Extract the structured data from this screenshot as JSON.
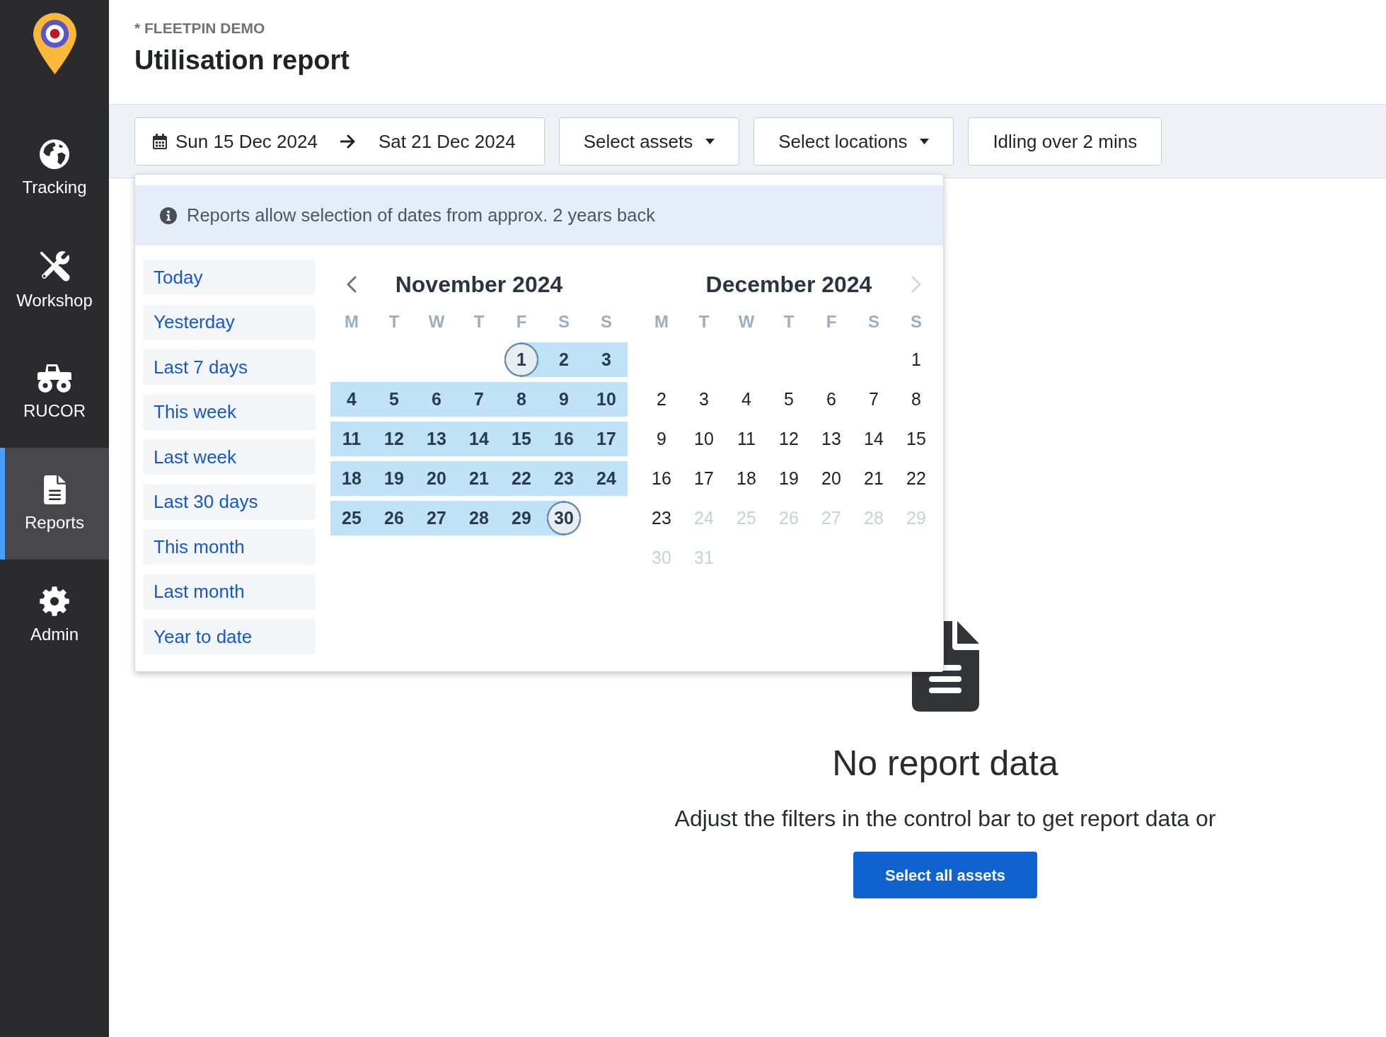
{
  "sidebar": {
    "items": [
      {
        "label": "Tracking",
        "selected": false
      },
      {
        "label": "Workshop",
        "selected": false
      },
      {
        "label": "RUCOR",
        "selected": false
      },
      {
        "label": "Reports",
        "selected": true
      },
      {
        "label": "Admin",
        "selected": false
      }
    ]
  },
  "header": {
    "account": "* FLEETPIN DEMO",
    "title": "Utilisation report"
  },
  "filters": [
    {
      "kind": "date_range",
      "start": "Sun 15 Dec 2024",
      "end": "Sat 21 Dec 2024",
      "expanded": true,
      "picker": {
        "notice": "Reports allow selection of dates from approx. 2 years back",
        "presets": [
          "Today",
          "Yesterday",
          "Last 7 days",
          "This week",
          "Last week",
          "Last 30 days",
          "This month",
          "Last month",
          "Year to date"
        ],
        "prev_button": {
          "disabled": false
        },
        "next_button": {
          "disabled": true
        },
        "months": [
          {
            "title": "November 2024",
            "weekdays": [
              "M",
              "T",
              "W",
              "T",
              "F",
              "S",
              "S"
            ],
            "weeks": [
              [
                {
                  "day": "1",
                  "kind": "range_start",
                  "disabled": false
                },
                {
                  "day": "2",
                  "kind": "range_middle",
                  "disabled": false
                },
                {
                  "day": "3",
                  "kind": "range_middle",
                  "disabled": false
                }
              ],
              [
                {
                  "day": "4",
                  "kind": "range_middle",
                  "disabled": false
                },
                {
                  "day": "5",
                  "kind": "range_middle",
                  "disabled": false
                },
                {
                  "day": "6",
                  "kind": "range_middle",
                  "disabled": false
                },
                {
                  "day": "7",
                  "kind": "range_middle",
                  "disabled": false
                },
                {
                  "day": "8",
                  "kind": "range_middle",
                  "disabled": false
                },
                {
                  "day": "9",
                  "kind": "range_middle",
                  "disabled": false
                },
                {
                  "day": "10",
                  "kind": "range_middle",
                  "disabled": false
                }
              ],
              [
                {
                  "day": "11",
                  "kind": "range_middle",
                  "disabled": false
                },
                {
                  "day": "12",
                  "kind": "range_middle",
                  "disabled": false
                },
                {
                  "day": "13",
                  "kind": "range_middle",
                  "disabled": false
                },
                {
                  "day": "14",
                  "kind": "range_middle",
                  "disabled": false
                },
                {
                  "day": "15",
                  "kind": "range_middle",
                  "disabled": false
                },
                {
                  "day": "16",
                  "kind": "range_middle",
                  "disabled": false
                },
                {
                  "day": "17",
                  "kind": "range_middle",
                  "disabled": false
                }
              ],
              [
                {
                  "day": "18",
                  "kind": "range_middle",
                  "disabled": false
                },
                {
                  "day": "19",
                  "kind": "range_middle",
                  "disabled": false
                },
                {
                  "day": "20",
                  "kind": "range_middle",
                  "disabled": false
                },
                {
                  "day": "21",
                  "kind": "range_middle",
                  "disabled": false
                },
                {
                  "day": "22",
                  "kind": "range_middle",
                  "disabled": false
                },
                {
                  "day": "23",
                  "kind": "range_middle",
                  "disabled": false
                },
                {
                  "day": "24",
                  "kind": "range_middle",
                  "disabled": false
                }
              ],
              [
                {
                  "day": "25",
                  "kind": "range_middle",
                  "disabled": false
                },
                {
                  "day": "26",
                  "kind": "range_middle",
                  "disabled": false
                },
                {
                  "day": "27",
                  "kind": "range_middle",
                  "disabled": false
                },
                {
                  "day": "28",
                  "kind": "range_middle",
                  "disabled": false
                },
                {
                  "day": "29",
                  "kind": "range_middle",
                  "disabled": false
                },
                {
                  "day": "30",
                  "kind": "range_end",
                  "disabled": false
                }
              ]
            ]
          },
          {
            "title": "December 2024",
            "weekdays": [
              "M",
              "T",
              "W",
              "T",
              "F",
              "S",
              "S"
            ],
            "weeks": [
              [
                {
                  "day": "1",
                  "kind": "plain",
                  "disabled": false
                }
              ],
              [
                {
                  "day": "2",
                  "kind": "plain",
                  "disabled": false
                },
                {
                  "day": "3",
                  "kind": "plain",
                  "disabled": false
                },
                {
                  "day": "4",
                  "kind": "plain",
                  "disabled": false
                },
                {
                  "day": "5",
                  "kind": "plain",
                  "disabled": false
                },
                {
                  "day": "6",
                  "kind": "plain",
                  "disabled": false
                },
                {
                  "day": "7",
                  "kind": "plain",
                  "disabled": false
                },
                {
                  "day": "8",
                  "kind": "plain",
                  "disabled": false
                }
              ],
              [
                {
                  "day": "9",
                  "kind": "plain",
                  "disabled": false
                },
                {
                  "day": "10",
                  "kind": "plain",
                  "disabled": false
                },
                {
                  "day": "11",
                  "kind": "plain",
                  "disabled": false
                },
                {
                  "day": "12",
                  "kind": "plain",
                  "disabled": false
                },
                {
                  "day": "13",
                  "kind": "plain",
                  "disabled": false
                },
                {
                  "day": "14",
                  "kind": "plain",
                  "disabled": false
                },
                {
                  "day": "15",
                  "kind": "plain",
                  "disabled": false
                }
              ],
              [
                {
                  "day": "16",
                  "kind": "plain",
                  "disabled": false
                },
                {
                  "day": "17",
                  "kind": "plain",
                  "disabled": false
                },
                {
                  "day": "18",
                  "kind": "plain",
                  "disabled": false
                },
                {
                  "day": "19",
                  "kind": "plain",
                  "disabled": false
                },
                {
                  "day": "20",
                  "kind": "plain",
                  "disabled": false
                },
                {
                  "day": "21",
                  "kind": "plain",
                  "disabled": false
                },
                {
                  "day": "22",
                  "kind": "plain",
                  "disabled": false
                }
              ],
              [
                {
                  "day": "23",
                  "kind": "plain",
                  "disabled": false
                },
                {
                  "day": "24",
                  "kind": "plain",
                  "disabled": true
                },
                {
                  "day": "25",
                  "kind": "plain",
                  "disabled": true
                },
                {
                  "day": "26",
                  "kind": "plain",
                  "disabled": true
                },
                {
                  "day": "27",
                  "kind": "plain",
                  "disabled": true
                },
                {
                  "day": "28",
                  "kind": "plain",
                  "disabled": true
                },
                {
                  "day": "29",
                  "kind": "plain",
                  "disabled": true
                }
              ],
              [
                {
                  "day": "30",
                  "kind": "plain",
                  "disabled": true
                },
                {
                  "day": "31",
                  "kind": "plain",
                  "disabled": true
                }
              ]
            ]
          }
        ]
      }
    },
    {
      "kind": "dropdown",
      "label": "Select assets"
    },
    {
      "kind": "dropdown",
      "label": "Select locations"
    },
    {
      "kind": "button",
      "label": "Idling over 2 mins"
    }
  ],
  "empty_state": {
    "title": "No report data",
    "message": "Adjust the filters in the control bar to get report data or",
    "button": "Select all assets"
  }
}
